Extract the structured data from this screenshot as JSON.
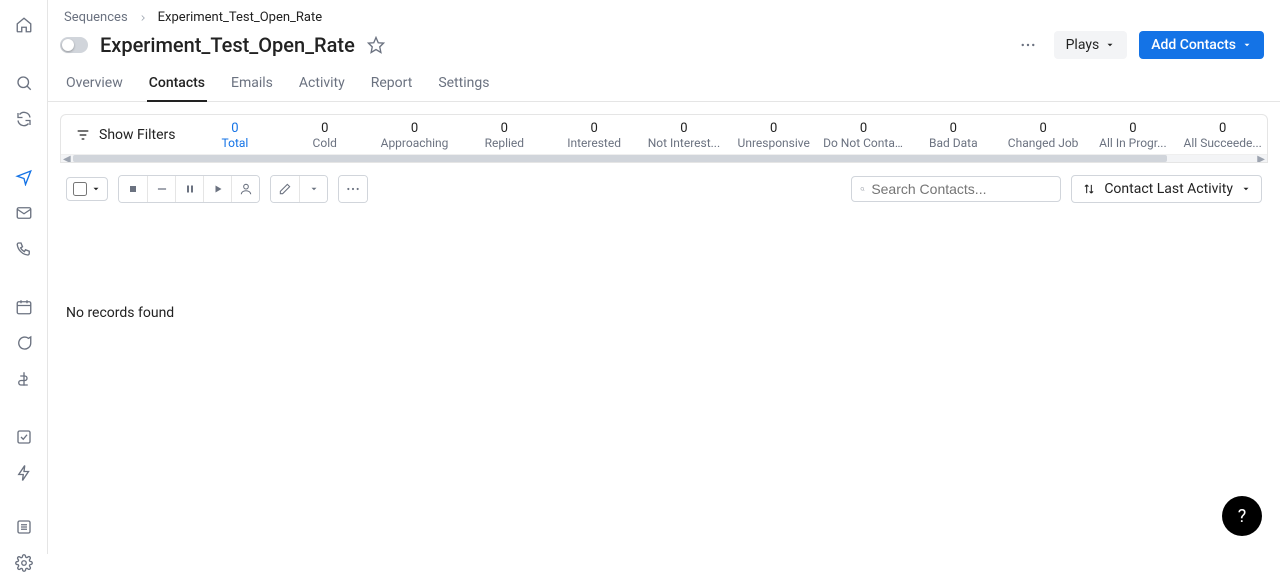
{
  "breadcrumb": {
    "root": "Sequences",
    "current": "Experiment_Test_Open_Rate"
  },
  "page": {
    "title": "Experiment_Test_Open_Rate",
    "plays_label": "Plays",
    "add_contacts_label": "Add Contacts"
  },
  "tabs": [
    {
      "label": "Overview"
    },
    {
      "label": "Contacts"
    },
    {
      "label": "Emails"
    },
    {
      "label": "Activity"
    },
    {
      "label": "Report"
    },
    {
      "label": "Settings"
    }
  ],
  "filters_button": "Show Filters",
  "status_cells": [
    {
      "count": "0",
      "label": "Total"
    },
    {
      "count": "0",
      "label": "Cold"
    },
    {
      "count": "0",
      "label": "Approaching"
    },
    {
      "count": "0",
      "label": "Replied"
    },
    {
      "count": "0",
      "label": "Interested"
    },
    {
      "count": "0",
      "label": "Not Interest..."
    },
    {
      "count": "0",
      "label": "Unresponsive"
    },
    {
      "count": "0",
      "label": "Do Not Conta..."
    },
    {
      "count": "0",
      "label": "Bad Data"
    },
    {
      "count": "0",
      "label": "Changed Job"
    },
    {
      "count": "0",
      "label": "All In Progr..."
    },
    {
      "count": "0",
      "label": "All Succeede..."
    }
  ],
  "search": {
    "placeholder": "Search Contacts..."
  },
  "sort": {
    "label": "Contact Last Activity"
  },
  "empty_state": "No records found",
  "help_fab": "?"
}
